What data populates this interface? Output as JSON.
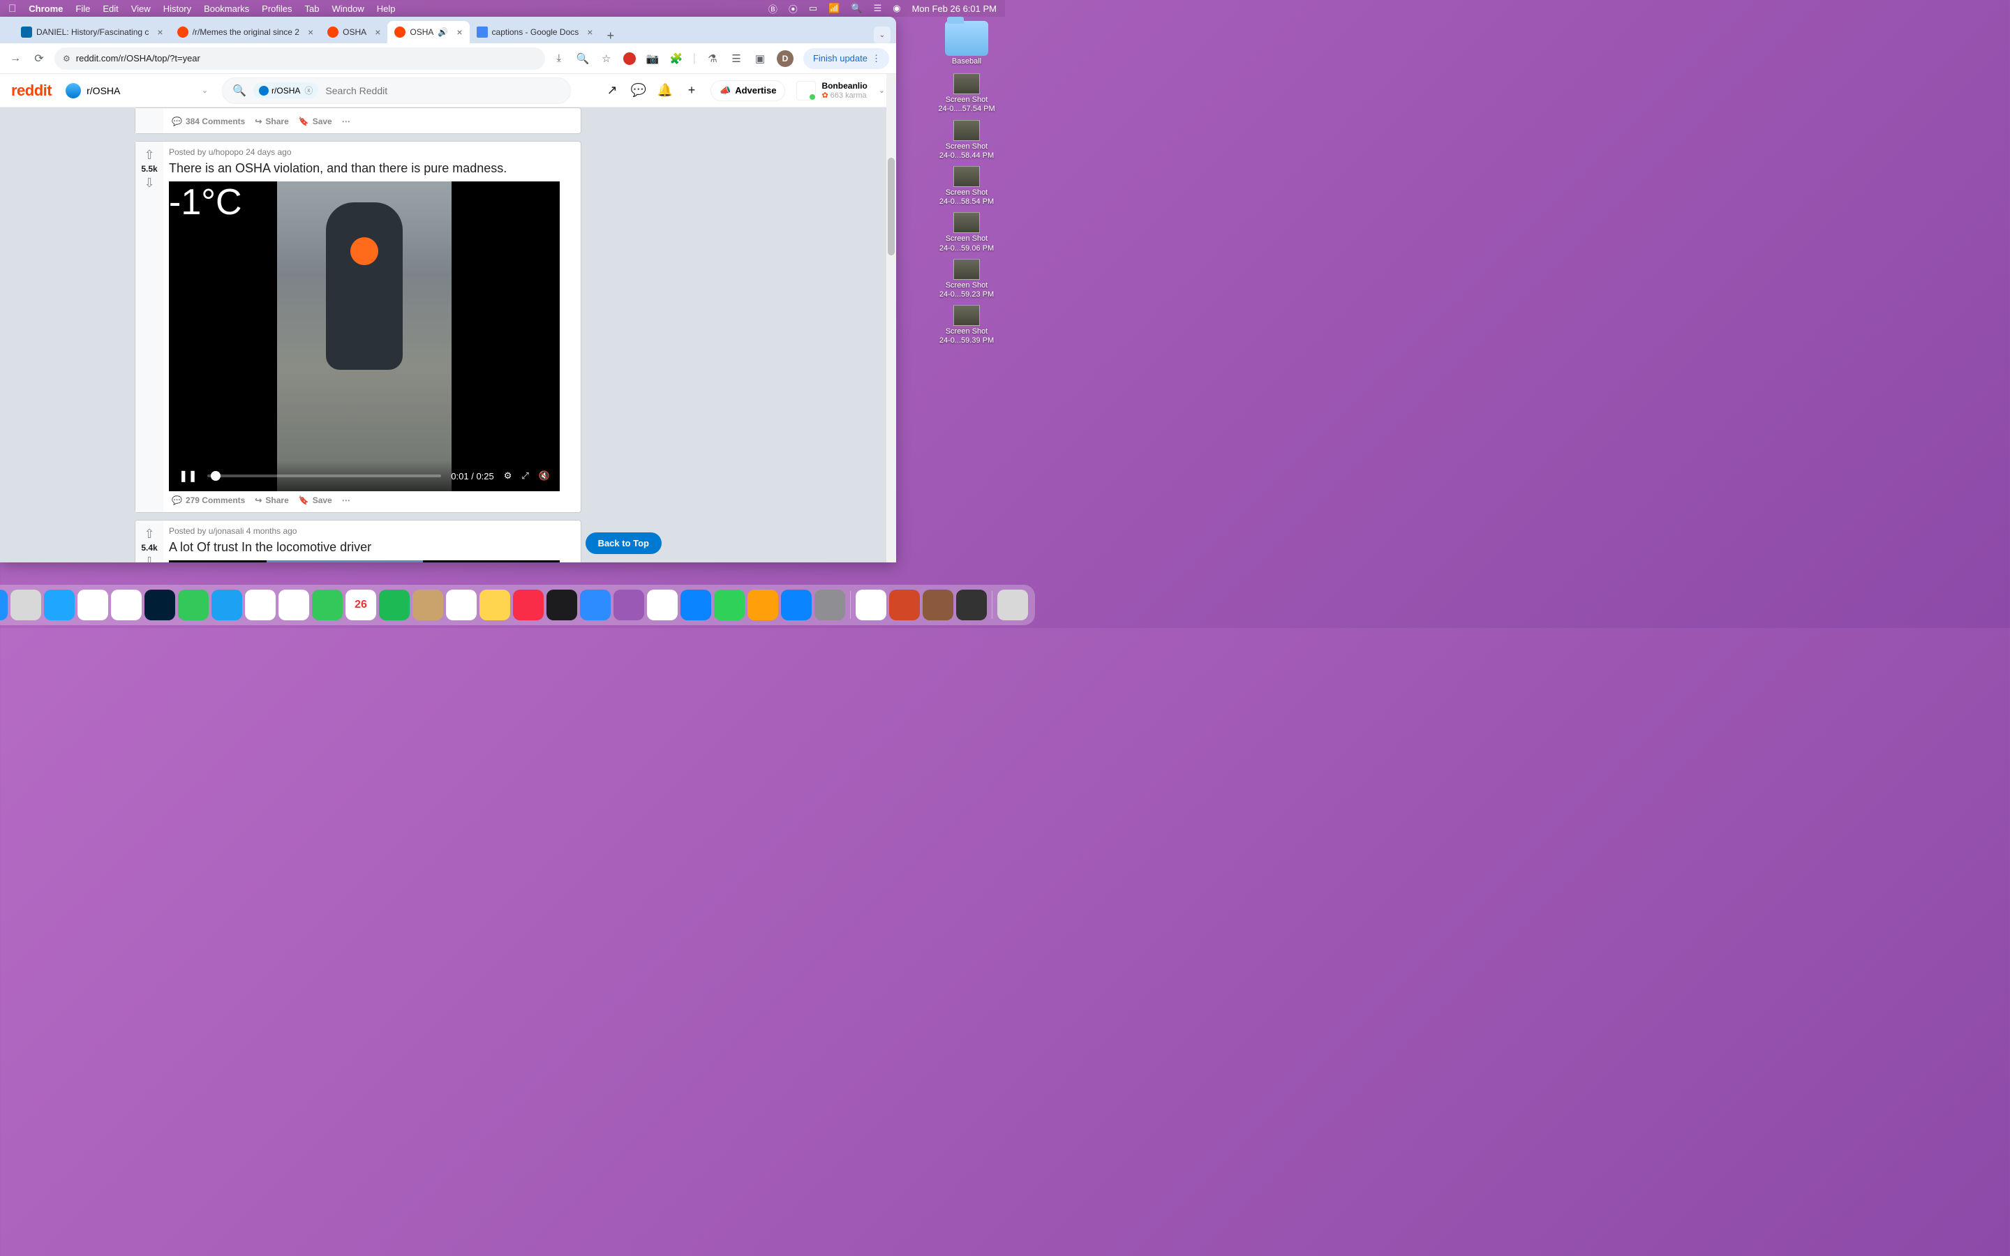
{
  "menubar": {
    "app": "Chrome",
    "items": [
      "File",
      "Edit",
      "View",
      "History",
      "Bookmarks",
      "Profiles",
      "Tab",
      "Window",
      "Help"
    ],
    "clock": "Mon Feb 26  6:01 PM"
  },
  "tabs": [
    {
      "title": "DANIEL: History/Fascinating c",
      "fav": "trello"
    },
    {
      "title": "/r/Memes the original since 2",
      "fav": "reddit"
    },
    {
      "title": "OSHA",
      "fav": "reddit"
    },
    {
      "title": "OSHA",
      "fav": "reddit",
      "active": true,
      "audio": true
    },
    {
      "title": "captions - Google Docs",
      "fav": "docs"
    }
  ],
  "url": "reddit.com/r/OSHA/top/?t=year",
  "finish_update": "Finish update",
  "avatar_letter": "D",
  "reddit": {
    "logo": "reddit",
    "community": "r/OSHA",
    "search_chip": "r/OSHA",
    "search_placeholder": "Search Reddit",
    "advertise": "Advertise",
    "username": "Bonbeanlio",
    "karma": "663 karma"
  },
  "posts": {
    "prev_actions": {
      "comments": "384 Comments",
      "share": "Share",
      "save": "Save"
    },
    "main": {
      "score": "5.5k",
      "meta_prefix": "Posted by",
      "author": "u/hopopo",
      "time": "24 days ago",
      "title": "There is an OSHA violation, and than there is pure madness.",
      "temp": "-1°C",
      "video": {
        "current": "0:01",
        "total": "0:25"
      },
      "actions": {
        "comments": "279 Comments",
        "share": "Share",
        "save": "Save"
      }
    },
    "next": {
      "score": "5.4k",
      "meta_prefix": "Posted by",
      "author": "u/jonasali",
      "time": "4 months ago",
      "title": "A lot Of trust In the locomotive driver"
    }
  },
  "back_to_top": "Back to Top",
  "desktop": {
    "folder": "Baseball",
    "shots": [
      {
        "l1": "Screen Shot",
        "l2": "24-0....57.54 PM"
      },
      {
        "l1": "Screen Shot",
        "l2": "24-0...58.44 PM"
      },
      {
        "l1": "Screen Shot",
        "l2": "24-0...58.54 PM"
      },
      {
        "l1": "Screen Shot",
        "l2": "24-0...59.06 PM"
      },
      {
        "l1": "Screen Shot",
        "l2": "24-0...59.23 PM"
      },
      {
        "l1": "Screen Shot",
        "l2": "24-0...59.39 PM"
      }
    ]
  },
  "dock": [
    {
      "name": "finder",
      "bg": "#1e90ff"
    },
    {
      "name": "launchpad",
      "bg": "#d8d8d8"
    },
    {
      "name": "safari",
      "bg": "#1fa6ff"
    },
    {
      "name": "chrome",
      "bg": "#fff"
    },
    {
      "name": "slack",
      "bg": "#fff"
    },
    {
      "name": "photoshop",
      "bg": "#001e36"
    },
    {
      "name": "messages",
      "bg": "#34c759"
    },
    {
      "name": "mail",
      "bg": "#1da1f2"
    },
    {
      "name": "maps",
      "bg": "#fff"
    },
    {
      "name": "photos",
      "bg": "#fff"
    },
    {
      "name": "facetime",
      "bg": "#34c759"
    },
    {
      "name": "calendar",
      "bg": "#fff",
      "text": "26"
    },
    {
      "name": "spotify",
      "bg": "#1db954"
    },
    {
      "name": "contacts",
      "bg": "#c9a36b"
    },
    {
      "name": "reminders",
      "bg": "#fff"
    },
    {
      "name": "notes",
      "bg": "#ffd54f"
    },
    {
      "name": "music",
      "bg": "#fa2d48"
    },
    {
      "name": "tv",
      "bg": "#1c1c1e"
    },
    {
      "name": "zoom",
      "bg": "#2d8cff"
    },
    {
      "name": "podcasts",
      "bg": "#9b59b6"
    },
    {
      "name": "news",
      "bg": "#fff"
    },
    {
      "name": "keynote",
      "bg": "#0a84ff"
    },
    {
      "name": "numbers",
      "bg": "#30d158"
    },
    {
      "name": "pages",
      "bg": "#ff9f0a"
    },
    {
      "name": "appstore",
      "bg": "#0a84ff"
    },
    {
      "name": "settings",
      "bg": "#8e8e93"
    },
    {
      "name": "screenshot",
      "bg": "#fff"
    },
    {
      "name": "powerpoint",
      "bg": "#d24726"
    },
    {
      "name": "dictionary",
      "bg": "#8b5a3c"
    },
    {
      "name": "photobooth",
      "bg": "#333"
    },
    {
      "name": "trash",
      "bg": "#d8d8d8"
    }
  ]
}
